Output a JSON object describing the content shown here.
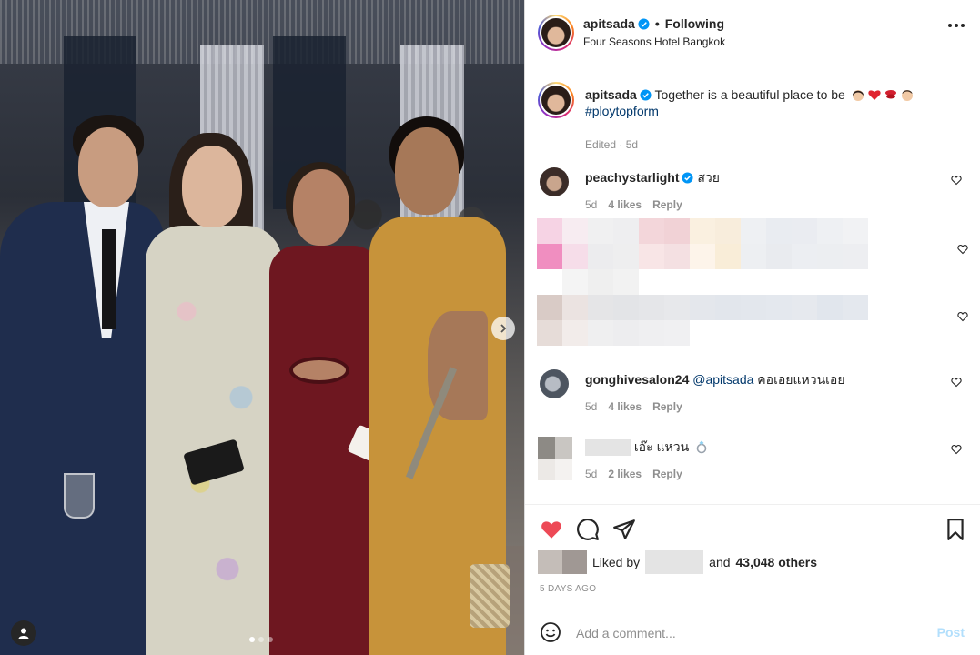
{
  "header": {
    "username": "apitsada",
    "separator": "•",
    "follow_status": "Following",
    "location": "Four Seasons Hotel Bangkok"
  },
  "caption": {
    "username": "apitsada",
    "text": "Together is a beautiful place to be",
    "hashtag": "#ploytopform",
    "meta": "Edited · 5d",
    "emojis": [
      "woman-emoji",
      "red-heart-emoji",
      "kiss-mark-emoji",
      "man-emoji"
    ]
  },
  "comments": [
    {
      "username": "peachystarlight",
      "text": "สวย",
      "time": "5d",
      "likes": "4 likes",
      "reply": "Reply"
    },
    {
      "username": "gonghivesalon24",
      "mention": "@apitsada",
      "text": "คอเอยแหวนเอย",
      "time": "5d",
      "likes": "4 likes",
      "reply": "Reply"
    },
    {
      "text": "เอ๊ะ แหวน",
      "time": "5d",
      "likes": "2 likes",
      "reply": "Reply"
    }
  ],
  "likes": {
    "prefix": "Liked by",
    "and": "and",
    "others": "43,048 others"
  },
  "timestamp": "5 DAYS AGO",
  "add_comment": {
    "placeholder": "Add a comment...",
    "post_label": "Post"
  },
  "colors": {
    "like_red": "#ed4956",
    "verified_blue": "#0095f6",
    "link_blue": "#00376b",
    "post_disabled": "#b2dffc",
    "muted": "#8e8e8e"
  },
  "carousel": {
    "slide_count": 3,
    "active_slide": 1
  }
}
